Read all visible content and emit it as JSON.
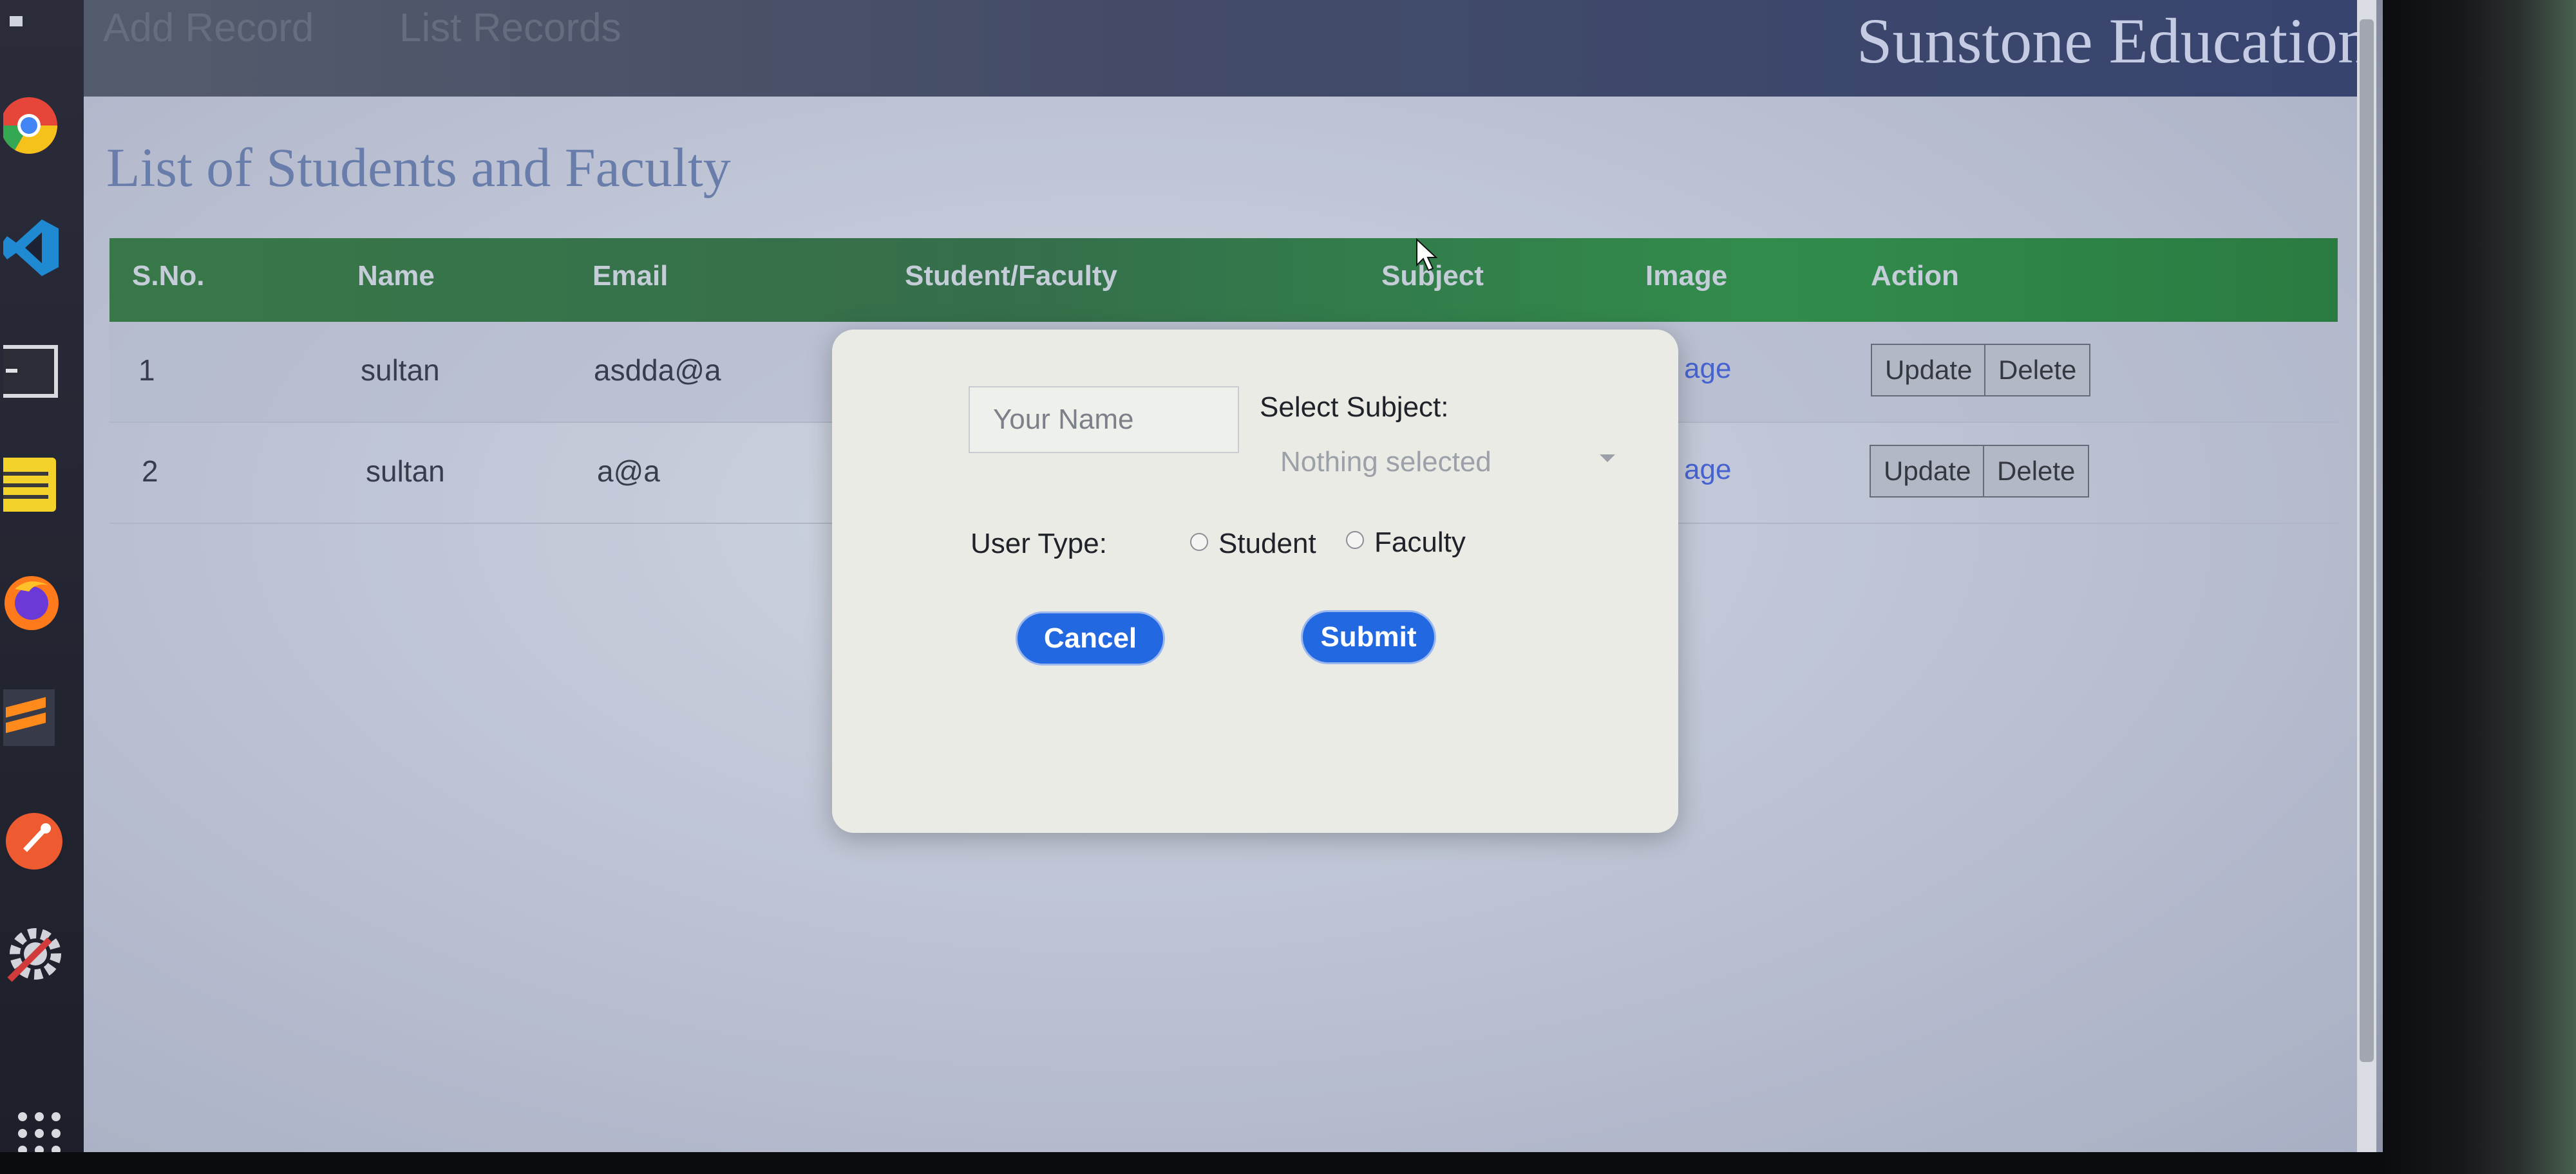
{
  "nav": {
    "links": [
      "Add Record",
      "List Records"
    ],
    "brand": "Sunstone Education"
  },
  "page": {
    "title": "List of Students and Faculty"
  },
  "table": {
    "headers": [
      "S.No.",
      "Name",
      "Email",
      "Student/Faculty",
      "Subject",
      "Image",
      "Action"
    ],
    "rows": [
      {
        "sno": "1",
        "name": "sultan",
        "email": "asdda@a",
        "image_link": "age",
        "update": "Update",
        "delete": "Delete"
      },
      {
        "sno": "2",
        "name": "sultan",
        "email": "a@a",
        "image_link": "age",
        "update": "Update",
        "delete": "Delete"
      }
    ]
  },
  "modal": {
    "name_placeholder": "Your Name",
    "subject_label": "Select Subject:",
    "subject_value": "Nothing selected",
    "user_type_label": "User Type:",
    "options": [
      "Student",
      "Faculty"
    ],
    "cancel": "Cancel",
    "submit": "Submit"
  },
  "colors": {
    "table_header": "#1a6b2a",
    "primary_button": "#2268e0",
    "brand_text": "#c9cfe6"
  },
  "dock": [
    "menu-icon",
    "chrome-icon",
    "vscode-icon",
    "terminal-icon",
    "notes-icon",
    "firefox-icon",
    "sublime-icon",
    "postman-icon",
    "settings-icon",
    "app-grid-icon"
  ]
}
